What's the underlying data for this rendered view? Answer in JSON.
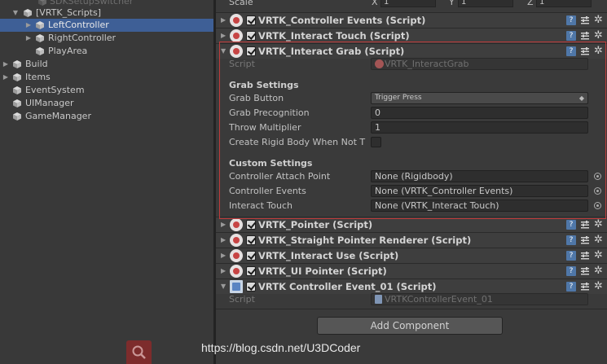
{
  "hierarchy": {
    "items": [
      {
        "label": "SDKSetupSwitcher",
        "dim": true
      },
      {
        "label": "[VRTK_Scripts]"
      },
      {
        "label": "LeftController",
        "selected": true
      },
      {
        "label": "RightController"
      },
      {
        "label": "PlayArea"
      },
      {
        "label": "Build"
      },
      {
        "label": "Items"
      },
      {
        "label": "EventSystem"
      },
      {
        "label": "UIManager"
      },
      {
        "label": "GameManager"
      }
    ]
  },
  "inspector": {
    "scale": {
      "label": "Scale",
      "x_label": "X",
      "x_value": "1",
      "y_label": "Y",
      "y_value": "1",
      "z_label": "Z",
      "z_value": "1"
    },
    "components": [
      {
        "title": "VRTK_Controller Events (Script)"
      },
      {
        "title": "VRTK_Interact Touch (Script)"
      },
      {
        "title": "VRTK_Interact Grab (Script)"
      },
      {
        "title": "VRTK_Pointer (Script)"
      },
      {
        "title": "VRTK_Straight Pointer Renderer (Script)"
      },
      {
        "title": "VRTK_Interact Use (Script)"
      },
      {
        "title": "VRTK_UI Pointer (Script)"
      },
      {
        "title": "VRTK Controller Event_01 (Script)"
      }
    ],
    "grab": {
      "script_label": "Script",
      "script_value": "VRTK_InteractGrab",
      "grab_settings_header": "Grab Settings",
      "grab_button_label": "Grab Button",
      "grab_button_value": "Trigger Press",
      "grab_precognition_label": "Grab Precognition",
      "grab_precognition_value": "0",
      "throw_multiplier_label": "Throw Multiplier",
      "throw_multiplier_value": "1",
      "create_rigid_body_label": "Create Rigid Body When Not T",
      "custom_settings_header": "Custom Settings",
      "controller_attach_label": "Controller Attach Point",
      "controller_attach_value": "None (Rigidbody)",
      "controller_events_label": "Controller Events",
      "controller_events_value": "None (VRTK_Controller Events)",
      "interact_touch_label": "Interact Touch",
      "interact_touch_value": "None (VRTK_Interact Touch)"
    },
    "event01": {
      "script_label": "Script",
      "script_value": "VRTKControllerEvent_01"
    },
    "help_icon_glyph": "?",
    "gear_icon_glyph": "✲",
    "add_component_label": "Add Component"
  },
  "watermark": "https://blog.csdn.net/U3DCoder",
  "colors": {
    "selection": "#3e5f96",
    "highlight_border": "#c13a3a",
    "help_icon": "#4f77a8"
  }
}
